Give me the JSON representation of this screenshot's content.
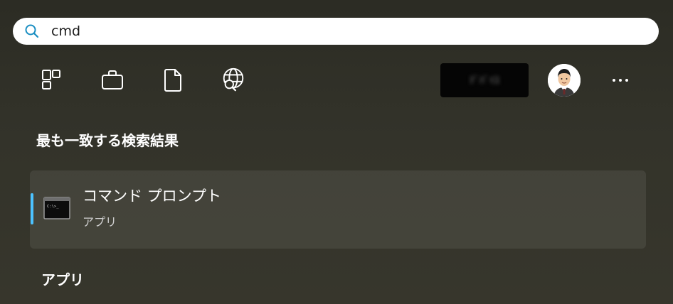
{
  "search": {
    "value": "cmd",
    "icon": "search-icon"
  },
  "filters": [
    {
      "name": "apps-filter-icon",
      "icon": "grid-apps-icon"
    },
    {
      "name": "work-filter-icon",
      "icon": "briefcase-icon"
    },
    {
      "name": "documents-filter-icon",
      "icon": "document-icon"
    },
    {
      "name": "web-filter-icon",
      "icon": "globe-search-icon"
    }
  ],
  "account": {
    "label": "ﾃﾞﾊﾞｲｽ"
  },
  "best_match": {
    "heading": "最も一致する検索結果",
    "title": "コマンド プロンプト",
    "subtitle": "アプリ",
    "icon": "command-prompt-icon",
    "accent_color": "#4cc2ff"
  },
  "apps_section": {
    "heading": "アプリ"
  }
}
